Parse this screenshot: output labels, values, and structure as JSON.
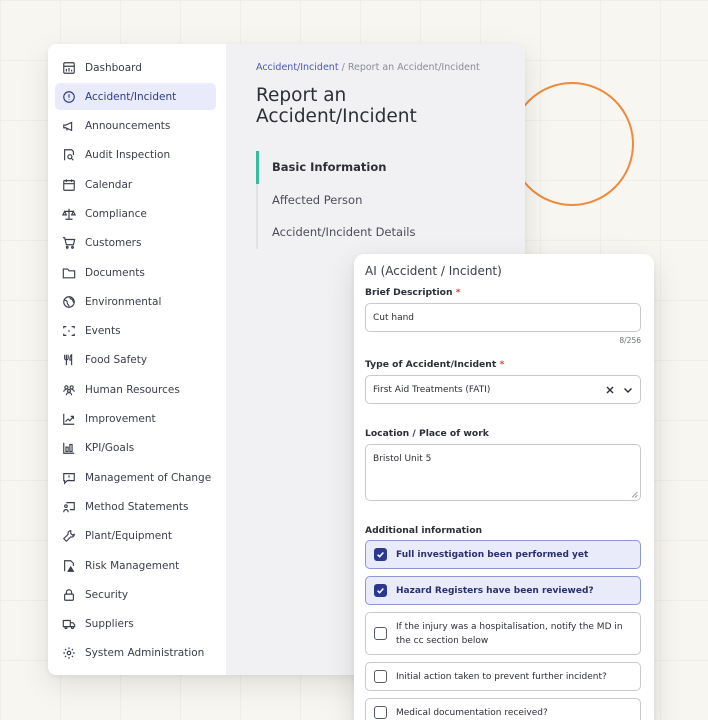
{
  "sidebar": {
    "items": [
      {
        "label": "Dashboard",
        "icon": "dashboard-icon"
      },
      {
        "label": "Accident/Incident",
        "icon": "alert-circle-icon",
        "active": true
      },
      {
        "label": "Announcements",
        "icon": "megaphone-icon"
      },
      {
        "label": "Audit Inspection",
        "icon": "audit-search-icon"
      },
      {
        "label": "Calendar",
        "icon": "calendar-icon"
      },
      {
        "label": "Compliance",
        "icon": "scales-icon"
      },
      {
        "label": "Customers",
        "icon": "cart-icon"
      },
      {
        "label": "Documents",
        "icon": "folder-icon"
      },
      {
        "label": "Environmental",
        "icon": "globe-icon"
      },
      {
        "label": "Events",
        "icon": "events-icon"
      },
      {
        "label": "Food Safety",
        "icon": "utensils-icon"
      },
      {
        "label": "Human Resources",
        "icon": "people-icon"
      },
      {
        "label": "Improvement",
        "icon": "trend-up-icon"
      },
      {
        "label": "KPI/Goals",
        "icon": "bar-chart-icon"
      },
      {
        "label": "Management of Change",
        "icon": "message-icon"
      },
      {
        "label": "Method Statements",
        "icon": "method-icon"
      },
      {
        "label": "Plant/Equipment",
        "icon": "wrench-icon"
      },
      {
        "label": "Risk Management",
        "icon": "risk-document-icon"
      },
      {
        "label": "Security",
        "icon": "lock-icon"
      },
      {
        "label": "Suppliers",
        "icon": "truck-icon"
      },
      {
        "label": "System Administration",
        "icon": "gear-icon"
      }
    ]
  },
  "breadcrumb": {
    "link": "Accident/Incident",
    "separator": "/",
    "current": "Report an Accident/Incident"
  },
  "page_title": "Report an Accident/Incident",
  "steps": [
    "Basic Information",
    "Affected Person",
    "Accident/Incident Details"
  ],
  "form": {
    "title": "AI (Accident / Incident)",
    "brief_label": "Brief Description",
    "brief_value": "Cut hand",
    "brief_counter": "8/256",
    "type_label": "Type of Accident/Incident",
    "type_value": "First Aid Treatments (FATI)",
    "location_label": "Location / Place of work",
    "location_value": "Bristol Unit 5",
    "additional_label": "Additional information",
    "required_mark": "*",
    "checks": [
      {
        "label": "Full investigation been performed yet",
        "checked": true
      },
      {
        "label": "Hazard Registers have been reviewed?",
        "checked": true
      },
      {
        "label": "If the injury was a hospitalisation, notify the MD in the cc section below",
        "checked": false
      },
      {
        "label": "Initial action taken to prevent further incident?",
        "checked": false
      },
      {
        "label": "Medical documentation received?",
        "checked": false
      }
    ]
  },
  "colors": {
    "accent": "#2c3890",
    "active_step": "#2fc09a",
    "circle": "#f08a3c",
    "required": "#e0453b"
  }
}
